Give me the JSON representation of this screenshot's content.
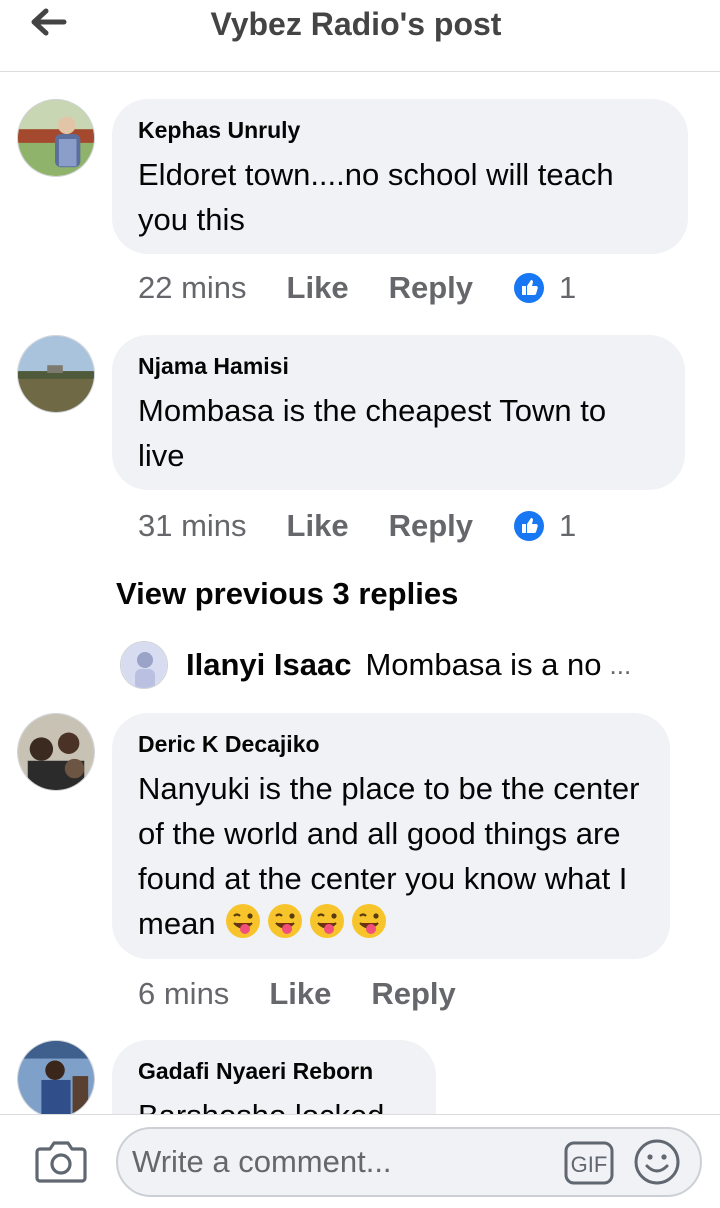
{
  "header": {
    "title": "Vybez Radio's post",
    "back_icon": "back-arrow-icon"
  },
  "comments": [
    {
      "author": "Kephas Unruly",
      "text": "Eldoret town....no school will teach you this",
      "time": "22 mins",
      "like_label": "Like",
      "reply_label": "Reply",
      "reaction_count": "1",
      "reaction_icon": "thumbs-up-icon"
    },
    {
      "author": "Njama Hamisi",
      "text": "Mombasa is the cheapest Town to live",
      "time": "31 mins",
      "like_label": "Like",
      "reply_label": "Reply",
      "reaction_count": "1",
      "reaction_icon": "thumbs-up-icon"
    },
    {
      "author": "Deric K Decajiko",
      "text": "Nanyuki is the place to be the center of the world  and all good things are found at the center you know what I mean",
      "emojis": [
        "winking-tongue-emoji",
        "winking-tongue-emoji",
        "winking-tongue-emoji",
        "winking-tongue-emoji"
      ],
      "time": "6 mins",
      "like_label": "Like",
      "reply_label": "Reply"
    },
    {
      "author": "Gadafi Nyaeri Reborn",
      "text": "Barshosho locked"
    }
  ],
  "view_previous": "View previous 3 replies",
  "reply_preview": {
    "author": "Ilanyi Isaac",
    "text": "Mombasa is a no",
    "more": "..."
  },
  "composer": {
    "placeholder": "Write a comment...",
    "camera_icon": "camera-icon",
    "gif_label": "GIF",
    "emoji_icon": "smiley-icon"
  },
  "colors": {
    "bubble": "#f0f2f5",
    "like_blue": "#1877f2",
    "secondary_text": "#65676b"
  }
}
